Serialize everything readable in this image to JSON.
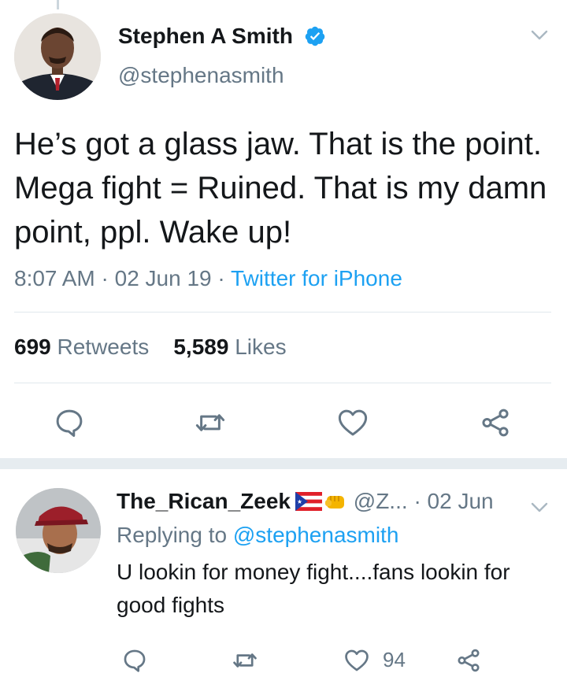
{
  "tweet": {
    "author_name": "Stephen A Smith",
    "author_handle": "@stephenasmith",
    "text": "He’s got a glass jaw. That is the point. Mega fight = Ruined. That is my damn point, ppl. Wake up!",
    "time": "8:07 AM",
    "date": "02 Jun 19",
    "source": "Twitter for iPhone",
    "retweets_count": "699",
    "retweets_label": "Retweets",
    "likes_count": "5,589",
    "likes_label": "Likes"
  },
  "reply": {
    "author_name": "The_Rican_Zeek",
    "author_handle": "@Z...",
    "date": "· 02 Jun",
    "replying_to_prefix": "Replying to",
    "replying_to_mention": "@stephenasmith",
    "text": "U lookin for money fight....fans lookin for good fights",
    "like_count": "94"
  },
  "colors": {
    "primary_text": "#14171a",
    "secondary_text": "#657786",
    "accent_blue": "#1da1f2",
    "divider": "#e1e8ed"
  },
  "icons": [
    "verified-badge-icon",
    "chevron-down-icon",
    "reply-icon",
    "retweet-icon",
    "like-icon",
    "share-icon",
    "puerto-rico-flag-icon",
    "fist-icon"
  ]
}
